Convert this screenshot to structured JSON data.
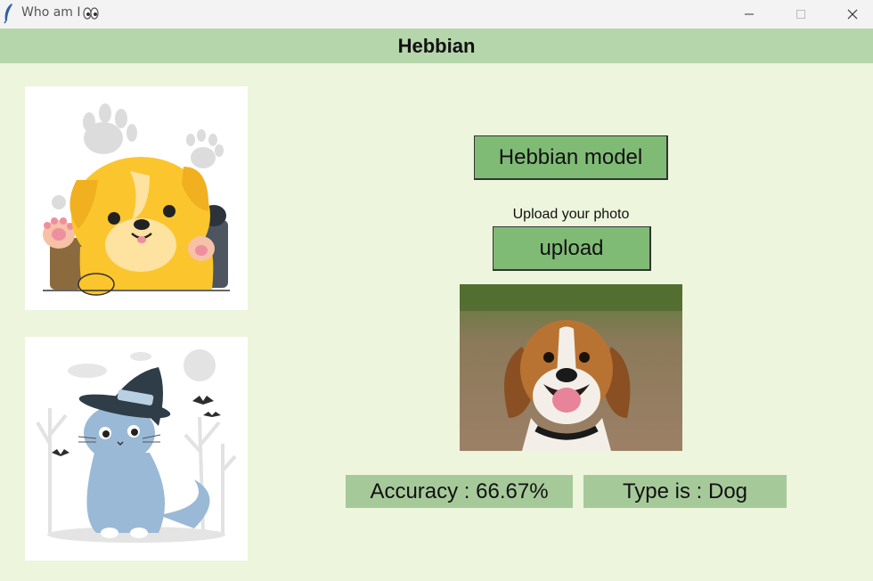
{
  "window": {
    "title": "Who am I",
    "title_icon": "feather-icon",
    "title_emoji": "eyes-icon"
  },
  "header": {
    "title": "Hebbian"
  },
  "illustrations": {
    "dog": "dog-illustration",
    "cat": "cat-witch-illustration"
  },
  "controls": {
    "model_button": "Hebbian model",
    "upload_prompt": "Upload your photo",
    "upload_button": "upload"
  },
  "photo": {
    "subject": "beagle-photo"
  },
  "results": {
    "accuracy": "Accuracy : 66.67%",
    "type": "Type is : Dog"
  },
  "colors": {
    "background": "#edf5dc",
    "header": "#b5d5aa",
    "button": "#80bb76",
    "result_box": "#a6c99a"
  }
}
